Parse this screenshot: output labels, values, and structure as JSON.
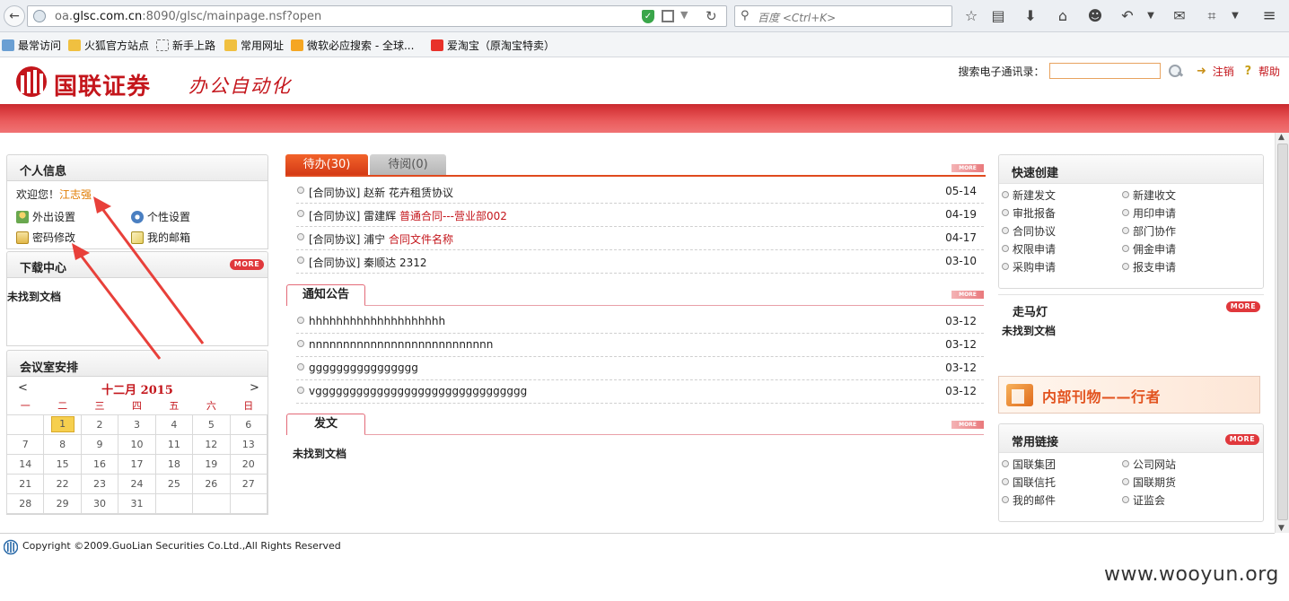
{
  "browser": {
    "url_prefix": "oa.",
    "url_host": "glsc.com.cn",
    "url_rest": ":8090/glsc/mainpage.nsf?open",
    "search_placeholder": "百度 <Ctrl+K>",
    "bookmarks": [
      "最常访问",
      "火狐官方站点",
      "新手上路",
      "常用网址",
      "微软必应搜索 - 全球...",
      "爱淘宝（原淘宝特卖）"
    ]
  },
  "header": {
    "logo_text": "国联证券",
    "logo_sub": "办公自动化",
    "directory_label": "搜索电子通讯录：",
    "logout": "注销",
    "help": "帮助"
  },
  "personal": {
    "title": "个人信息",
    "welcome": "欢迎您！",
    "user_name": "江志强",
    "items": [
      "外出设置",
      "个性设置",
      "密码修改",
      "我的邮箱"
    ]
  },
  "download": {
    "title": "下载中心",
    "more": "MORE",
    "empty": "未找到文档"
  },
  "meeting": {
    "title": "会议室安排",
    "prev": "<",
    "next": ">",
    "month": "十二月 2015",
    "weekdays": [
      "一",
      "二",
      "三",
      "四",
      "五",
      "六",
      "日"
    ],
    "weeks": [
      [
        "",
        "1",
        "2",
        "3",
        "4",
        "5",
        "6"
      ],
      [
        "7",
        "8",
        "9",
        "10",
        "11",
        "12",
        "13"
      ],
      [
        "14",
        "15",
        "16",
        "17",
        "18",
        "19",
        "20"
      ],
      [
        "21",
        "22",
        "23",
        "24",
        "25",
        "26",
        "27"
      ],
      [
        "28",
        "29",
        "30",
        "31",
        "",
        "",
        ""
      ]
    ],
    "today": "1"
  },
  "todo": {
    "tab_active": "待办(30)",
    "tab_inactive": "待阅(0)",
    "more": "MORE",
    "rows": [
      {
        "prefix": "[合同协议] 赵新 花卉租赁协议",
        "red": "",
        "date": "05-14"
      },
      {
        "prefix": "[合同协议] 雷建辉 ",
        "red": "普通合同---营业部002",
        "date": "04-19"
      },
      {
        "prefix": "[合同协议] 浦宁 ",
        "red": "合同文件名称",
        "date": "04-17"
      },
      {
        "prefix": "[合同协议] 秦顺达 2312",
        "red": "",
        "date": "03-10"
      }
    ]
  },
  "notice": {
    "title": "通知公告",
    "more": "MORE",
    "rows": [
      {
        "text": "hhhhhhhhhhhhhhhhhhhh",
        "date": "03-12"
      },
      {
        "text": "nnnnnnnnnnnnnnnnnnnnnnnnnnn",
        "date": "03-12"
      },
      {
        "text": "gggggggggggggggg",
        "date": "03-12"
      },
      {
        "text": "vggggggggggggggggggggggggggggggg",
        "date": "03-12"
      }
    ]
  },
  "dispatch": {
    "title": "发文",
    "more": "MORE",
    "empty": "未找到文档"
  },
  "quick": {
    "title": "快速创建",
    "items": [
      "新建发文",
      "新建收文",
      "审批报备",
      "用印申请",
      "合同协议",
      "部门协作",
      "权限申请",
      "佣金申请",
      "采购申请",
      "报支申请"
    ]
  },
  "marquee": {
    "title": "走马灯",
    "more": "MORE",
    "empty": "未找到文档"
  },
  "banner": {
    "text": "内部刊物——行者"
  },
  "links": {
    "title": "常用链接",
    "more": "MORE",
    "items": [
      "国联集团",
      "公司网站",
      "国联信托",
      "国联期货",
      "我的邮件",
      "证监会"
    ]
  },
  "footer": {
    "copyright": "Copyright ©2009.GuoLian Securities Co.Ltd.,All Rights Reserved"
  },
  "watermark": "www.wooyun.org",
  "colors": {
    "brand_red": "#c4161c",
    "tab_orange": "#e04a1e",
    "more_red": "#e0383c"
  }
}
